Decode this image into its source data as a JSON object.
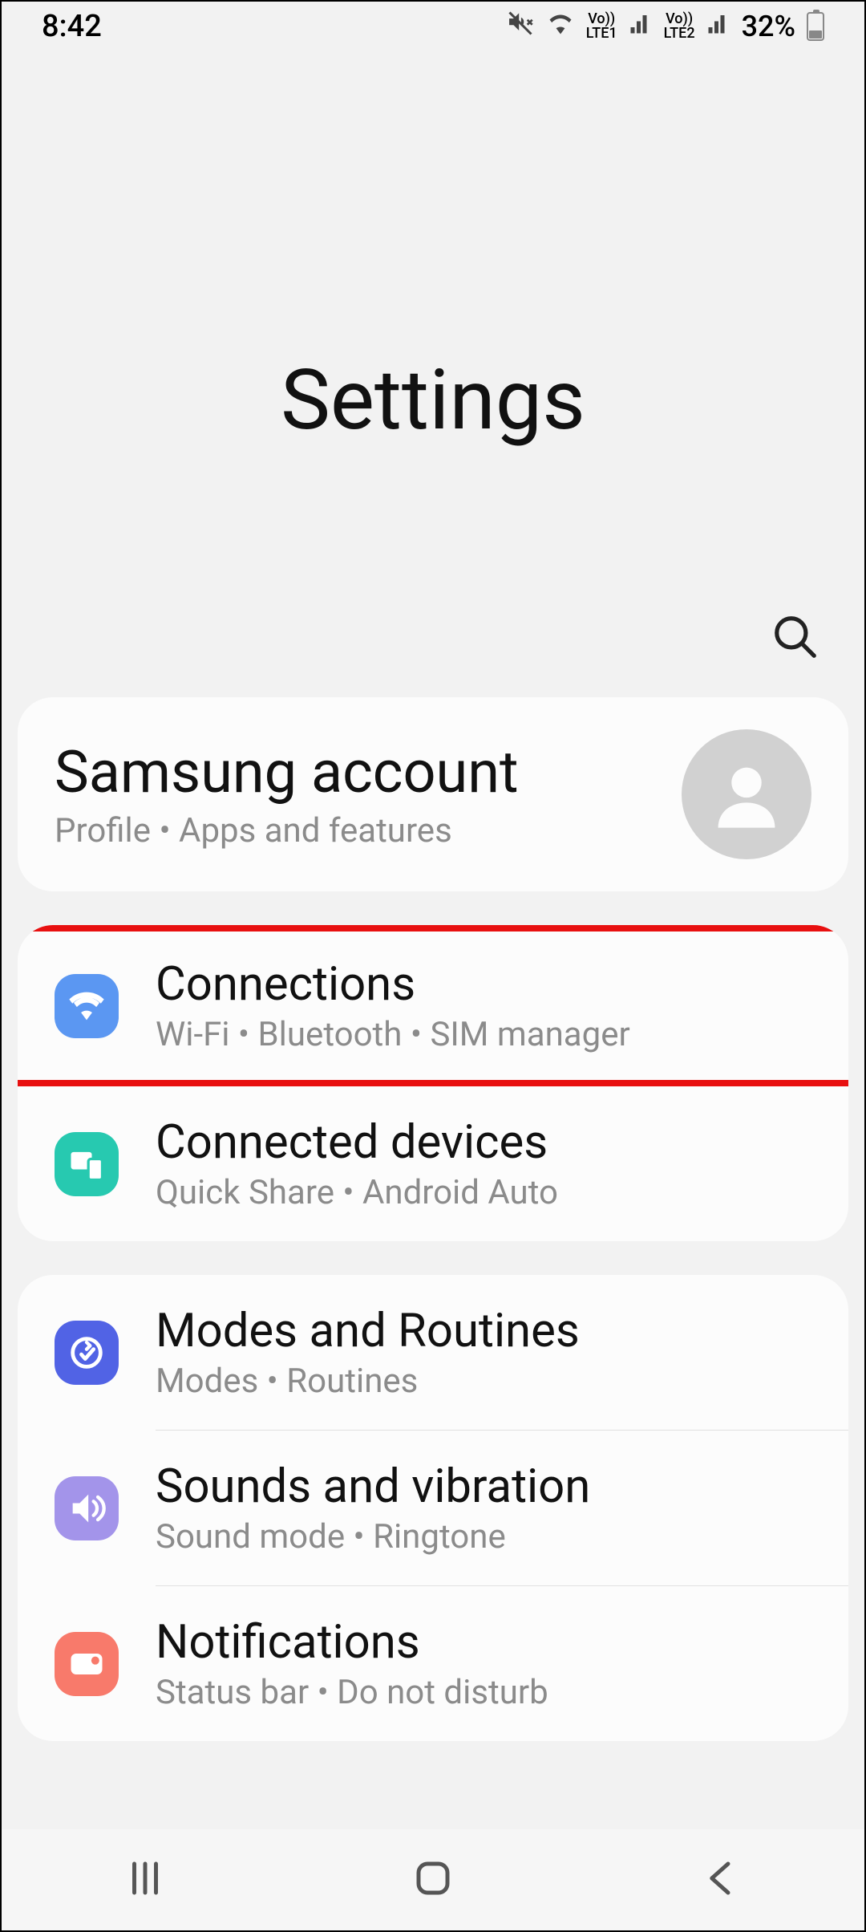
{
  "status": {
    "time": "8:42",
    "sim1": "Vo))\nLTE1",
    "sim2": "Vo))\nLTE2",
    "battery_pct": "32%"
  },
  "header": {
    "title": "Settings"
  },
  "account": {
    "title": "Samsung account",
    "subtitle": "Profile  •  Apps and features"
  },
  "group1": {
    "connections": {
      "title": "Connections",
      "subtitle": "Wi-Fi  •  Bluetooth  •  SIM manager"
    },
    "connected_devices": {
      "title": "Connected devices",
      "subtitle": "Quick Share  •  Android Auto"
    }
  },
  "group2": {
    "modes": {
      "title": "Modes and Routines",
      "subtitle": "Modes  •  Routines"
    },
    "sounds": {
      "title": "Sounds and vibration",
      "subtitle": "Sound mode  •  Ringtone"
    },
    "notifications": {
      "title": "Notifications",
      "subtitle": "Status bar  •  Do not disturb"
    }
  },
  "colors": {
    "blue": "#5b97f2",
    "teal": "#27c9b0",
    "indigo": "#5163e5",
    "lavender": "#a394ea",
    "coral": "#f87a6b",
    "highlight_border": "#e81010"
  }
}
